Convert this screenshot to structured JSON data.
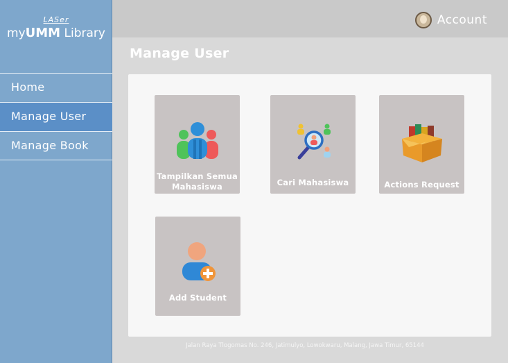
{
  "brand": {
    "top": "LASer",
    "prefix": "my",
    "bold": "UMM",
    "suffix": " Library"
  },
  "header": {
    "account_label": "Account"
  },
  "sidebar": {
    "items": [
      {
        "label": "Home"
      },
      {
        "label": "Manage User"
      },
      {
        "label": "Manage Book"
      }
    ]
  },
  "page": {
    "title": "Manage User"
  },
  "cards": [
    {
      "label": "Tampilkan Semua Mahasiswa",
      "icon": "group-users-icon"
    },
    {
      "label": "Cari Mahasiswa",
      "icon": "search-users-icon"
    },
    {
      "label": "Actions Request",
      "icon": "book-box-icon"
    },
    {
      "label": "Add Student",
      "icon": "add-user-icon"
    }
  ],
  "footer": {
    "address": "Jalan Raya Tlogomas No. 246, Jatimulyo, Lowokwaru, Malang, Jawa Timur, 65144"
  },
  "colors": {
    "sidebar": "#7ea7cc",
    "active": "#5b8fc7",
    "topbar": "#c9c9c9",
    "card": "#c8c3c3"
  }
}
